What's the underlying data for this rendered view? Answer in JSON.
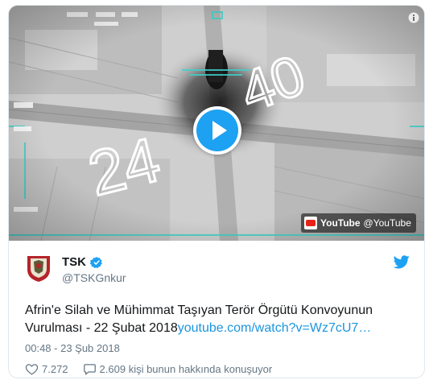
{
  "media": {
    "overlay_numbers": {
      "left": "24",
      "right": "40"
    },
    "provider_name": "YouTube",
    "provider_handle": "@YouTube"
  },
  "tweet": {
    "display_name": "TSK",
    "handle": "@TSKGnkur",
    "text": "Afrin'e Silah ve Mühimmat Taşıyan Terör Örgütü Konvoyunun Vurulması - 22 Şubat 2018",
    "link": "youtube.com/watch?v=Wz7cU7…",
    "timestamp": "00:48 - 23 Şub 2018",
    "likes": "7.272",
    "talking": "2.609 kişi bunun hakkında konuşuyor"
  },
  "icons": {
    "info": "info-icon",
    "play": "play-icon",
    "verified": "verified-badge-icon",
    "twitter": "twitter-bird-icon",
    "like": "heart-icon",
    "reply": "speech-bubble-icon"
  },
  "colors": {
    "accent": "#1da1f2",
    "link": "#1b95e0",
    "muted": "#657786"
  }
}
